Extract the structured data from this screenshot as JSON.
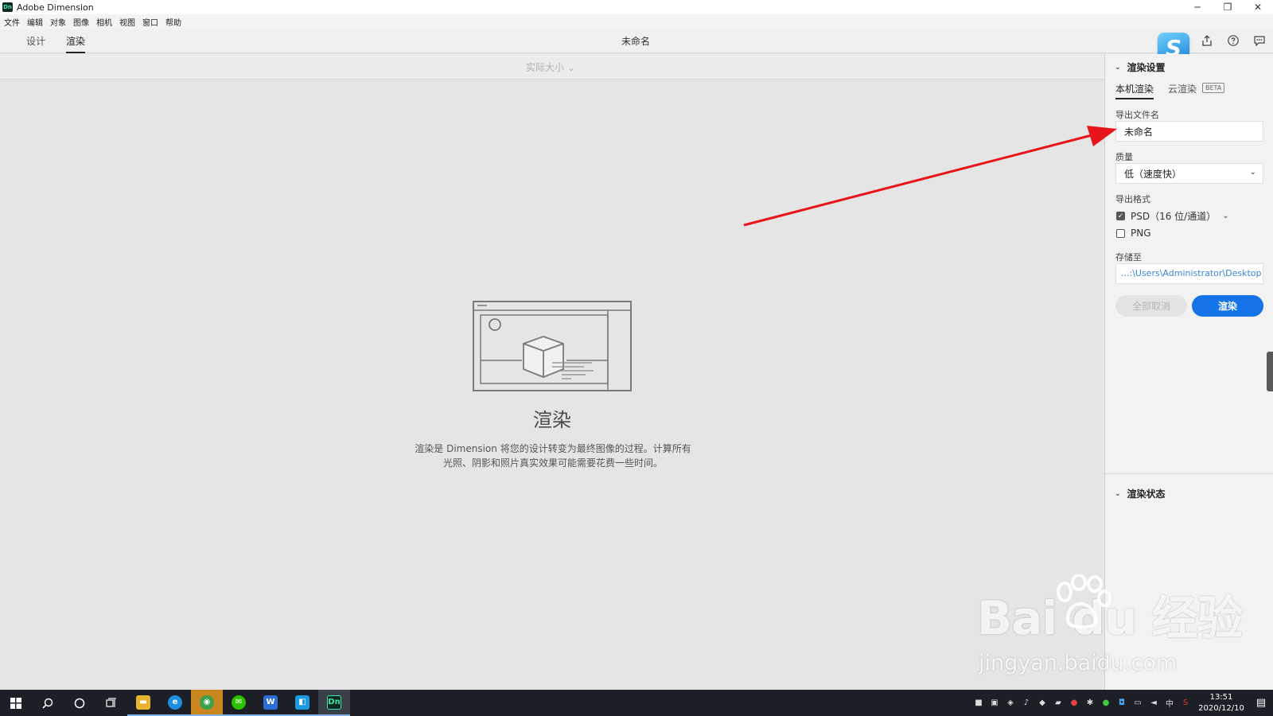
{
  "window": {
    "app_logo_text": "Dn",
    "title": "Adobe Dimension",
    "minimize_glyph": "─",
    "restore_glyph": "❐",
    "close_glyph": "✕"
  },
  "menu": [
    "文件",
    "编辑",
    "对象",
    "图像",
    "相机",
    "视图",
    "窗口",
    "帮助"
  ],
  "tabs": [
    {
      "label": "设计",
      "active": false
    },
    {
      "label": "渲染",
      "active": true
    }
  ],
  "document_title": "未命名",
  "top_right_icons": [
    "share-icon",
    "help-icon",
    "feedback-icon"
  ],
  "overlay_logo_letter": "S",
  "canvas": {
    "zoom_label": "实际大小 ⌄",
    "title": "渲染",
    "description": "渲染是 Dimension 将您的设计转变为最终图像的过程。计算所有光照、阴影和照片真实效果可能需要花费一些时间。"
  },
  "panel": {
    "render_settings": {
      "heading": "渲染设置",
      "tabs": [
        {
          "label": "本机渲染",
          "active": true
        },
        {
          "label": "云渲染",
          "active": false
        }
      ],
      "beta_badge": "BETA",
      "filename_label": "导出文件名",
      "filename_value": "未命名",
      "quality_label": "质量",
      "quality_value": "低（速度快）",
      "format_label": "导出格式",
      "formats": [
        {
          "label": "PSD（16 位/通道）",
          "checked": true,
          "has_dropdown": true
        },
        {
          "label": "PNG",
          "checked": false,
          "has_dropdown": false
        }
      ],
      "save_to_label": "存储至",
      "save_to_value": "...:\\Users\\Administrator\\Desktop",
      "cancel_all_label": "全部取消",
      "render_label": "渲染"
    },
    "render_status": {
      "heading": "渲染状态"
    }
  },
  "watermark": {
    "main": "Bai du 经验",
    "sub": "jingyan.baidu.com"
  },
  "taskbar": {
    "apps": [
      {
        "name": "file-explorer",
        "color": "#e8b430",
        "glyph": "▬",
        "active": false
      },
      {
        "name": "edge-browser",
        "color": "#1f8fe0",
        "glyph": "e",
        "active": false
      },
      {
        "name": "green-app",
        "color": "#3aa04a",
        "glyph": "◉",
        "active": false
      },
      {
        "name": "wechat",
        "color": "#2dc100",
        "glyph": "✉",
        "active": false
      },
      {
        "name": "writer-app",
        "color": "#2b6ed6",
        "glyph": "W",
        "active": false
      },
      {
        "name": "app-blue",
        "color": "#1a9be0",
        "glyph": "◧",
        "active": false
      },
      {
        "name": "adobe-dimension",
        "color": "#0b2a22",
        "glyph": "Dn",
        "active": true
      }
    ],
    "input_method": "中",
    "time": "13:51",
    "date": "2020/12/10"
  },
  "colors": {
    "accent": "#1473e6",
    "annotation_arrow": "#e8141a",
    "path_text": "#3b86d8"
  }
}
